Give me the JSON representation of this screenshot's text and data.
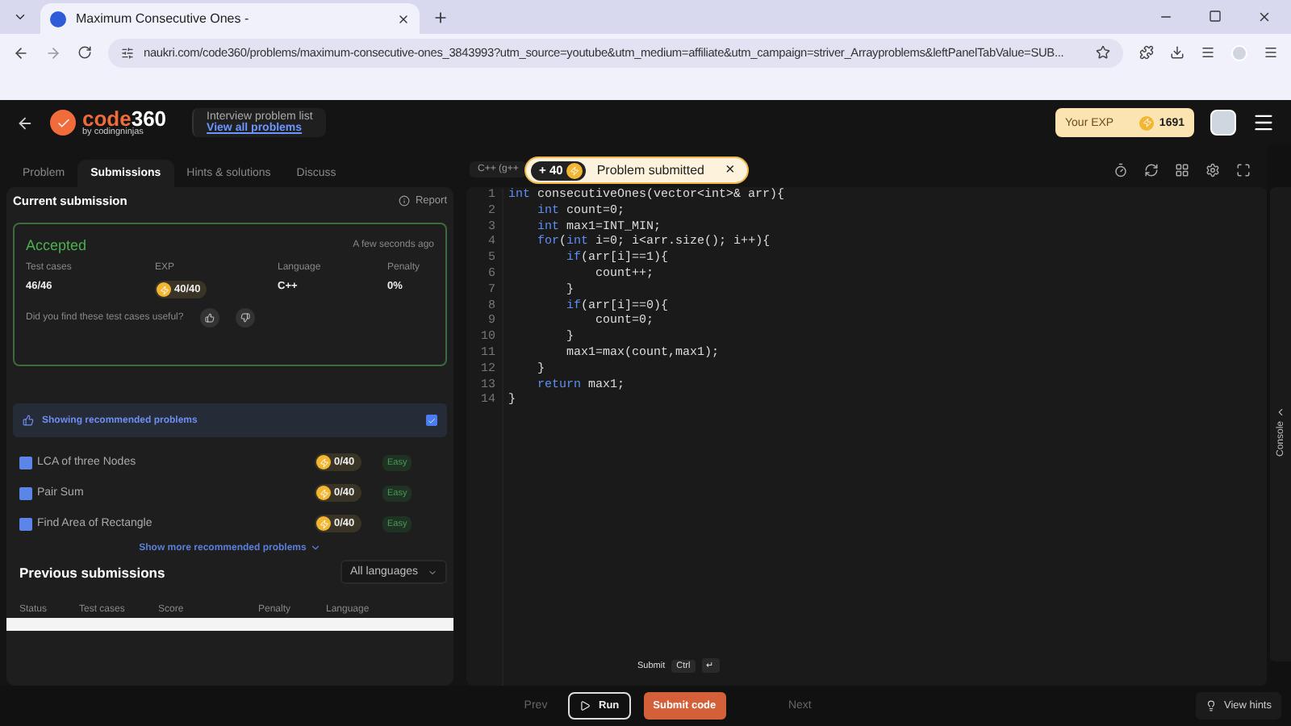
{
  "browser": {
    "tab_title": "Maximum Consecutive Ones -",
    "url": "naukri.com/code360/problems/maximum-consecutive-ones_3843993?utm_source=youtube&utm_medium=affiliate&utm_campaign=striver_Arrayproblems&leftPanelTabValue=SUB..."
  },
  "header": {
    "logo_main": "code",
    "logo_num": "360",
    "logo_sub": "by codingninjas",
    "breadcrumb": "Interview problem list",
    "link": "View all problems",
    "exp_label": "Your EXP",
    "exp_value": "1691"
  },
  "left_tabs": [
    {
      "label": "Problem",
      "selected": false
    },
    {
      "label": "Submissions",
      "selected": true
    },
    {
      "label": "Hints & solutions",
      "selected": false
    },
    {
      "label": "Discuss",
      "selected": false
    }
  ],
  "current_submission": {
    "title": "Current submission",
    "report": "Report",
    "status": "Accepted",
    "time": "A few seconds ago",
    "stats": [
      {
        "label": "Test cases",
        "value": "46/46",
        "kind": "text"
      },
      {
        "label": "EXP",
        "value": "40/40",
        "kind": "coin"
      },
      {
        "label": "Language",
        "value": "C++",
        "kind": "text"
      },
      {
        "label": "Penalty",
        "value": "0%",
        "kind": "text"
      }
    ],
    "feedback": "Did you find these test cases useful?"
  },
  "recommended": {
    "label": "Showing recommended problems",
    "checked": true,
    "items": [
      {
        "title": "LCA of three Nodes",
        "exp": "0/40",
        "difficulty": "Easy"
      },
      {
        "title": "Pair Sum",
        "exp": "0/40",
        "difficulty": "Easy"
      },
      {
        "title": "Find Area of Rectangle",
        "exp": "0/40",
        "difficulty": "Easy"
      }
    ],
    "more": "Show more recommended problems"
  },
  "previous": {
    "title": "Previous submissions",
    "filter": "All languages",
    "columns": [
      "Status",
      "Test cases",
      "Score",
      "Penalty",
      "Language"
    ]
  },
  "editor": {
    "language": "C++ (g++",
    "lines": [
      {
        "n": "1",
        "tokens": [
          {
            "text": "int",
            "kind": "keyword"
          },
          {
            "text": " consecutiveOnes(vector<int>& arr){",
            "kind": "plain"
          }
        ]
      },
      {
        "n": "2",
        "tokens": [
          {
            "text": "    int",
            "kind": "keyword"
          },
          {
            "text": " count=0;",
            "kind": "plain"
          }
        ]
      },
      {
        "n": "3",
        "tokens": [
          {
            "text": "    int",
            "kind": "keyword"
          },
          {
            "text": " max1=INT_MIN;",
            "kind": "plain"
          }
        ]
      },
      {
        "n": "4",
        "tokens": [
          {
            "text": "    for",
            "kind": "keyword"
          },
          {
            "text": "(",
            "kind": "plain"
          },
          {
            "text": "int",
            "kind": "keyword"
          },
          {
            "text": " i=0; i<arr.size(); i++){",
            "kind": "plain"
          }
        ]
      },
      {
        "n": "5",
        "tokens": [
          {
            "text": "        if",
            "kind": "keyword"
          },
          {
            "text": "(arr[i]==1){",
            "kind": "plain"
          }
        ]
      },
      {
        "n": "6",
        "tokens": [
          {
            "text": "            count++;",
            "kind": "plain"
          }
        ]
      },
      {
        "n": "7",
        "tokens": [
          {
            "text": "        }",
            "kind": "plain"
          }
        ]
      },
      {
        "n": "8",
        "tokens": [
          {
            "text": "        if",
            "kind": "keyword"
          },
          {
            "text": "(arr[i]==0){",
            "kind": "plain"
          }
        ]
      },
      {
        "n": "9",
        "tokens": [
          {
            "text": "            count=0;",
            "kind": "plain"
          }
        ]
      },
      {
        "n": "10",
        "tokens": [
          {
            "text": "        }",
            "kind": "plain"
          }
        ]
      },
      {
        "n": "11",
        "tokens": [
          {
            "text": "        max1=max(count,max1);",
            "kind": "plain"
          }
        ]
      },
      {
        "n": "12",
        "tokens": [
          {
            "text": "    }",
            "kind": "plain"
          }
        ]
      },
      {
        "n": "13",
        "tokens": [
          {
            "text": "    return",
            "kind": "keyword"
          },
          {
            "text": " max1;",
            "kind": "plain"
          }
        ]
      },
      {
        "n": "14",
        "tokens": [
          {
            "text": "}",
            "kind": "plain"
          }
        ]
      }
    ]
  },
  "toast": {
    "points": "+ 40",
    "message": "Problem submitted",
    "close": "×"
  },
  "tooltip": {
    "label": "Submit",
    "keys": [
      "Ctrl",
      "↵"
    ]
  },
  "footer": {
    "prev": "Prev",
    "run": "Run",
    "submit": "Submit code",
    "next": "Next",
    "hints": "View hints"
  },
  "console": "Console"
}
